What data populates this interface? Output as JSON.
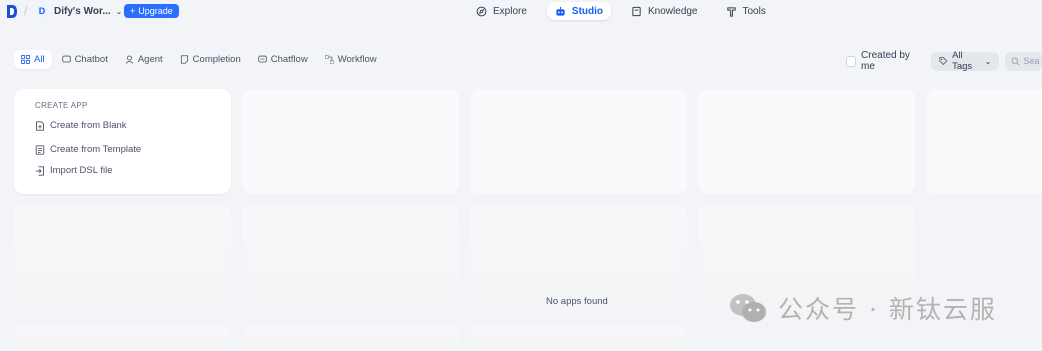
{
  "header": {
    "workspace_initial": "D",
    "workspace_name": "Dify's Wor...",
    "upgrade_label": "Upgrade",
    "nav": [
      {
        "label": "Explore",
        "icon": "compass-icon"
      },
      {
        "label": "Studio",
        "icon": "robot-icon",
        "active": true
      },
      {
        "label": "Knowledge",
        "icon": "book-icon"
      },
      {
        "label": "Tools",
        "icon": "hammer-icon"
      }
    ]
  },
  "tabs": [
    {
      "label": "All",
      "icon": "grid-icon",
      "active": true
    },
    {
      "label": "Chatbot",
      "icon": "chat-icon"
    },
    {
      "label": "Agent",
      "icon": "agent-icon"
    },
    {
      "label": "Completion",
      "icon": "document-icon"
    },
    {
      "label": "Chatflow",
      "icon": "chatflow-icon"
    },
    {
      "label": "Workflow",
      "icon": "workflow-icon"
    }
  ],
  "filters": {
    "created_by_me_label": "Created by me",
    "created_by_me_checked": false,
    "tags_label": "All Tags",
    "search_placeholder": "Sea"
  },
  "create_app": {
    "title": "CREATE APP",
    "items": [
      {
        "label": "Create from Blank",
        "icon": "blank-file-icon"
      },
      {
        "label": "Create from Template",
        "icon": "template-icon"
      },
      {
        "label": "Import DSL file",
        "icon": "import-icon"
      }
    ]
  },
  "empty_state": "No apps found",
  "watermark": {
    "text": "公众号 · 新钛云服",
    "icon": "wechat-icon"
  },
  "colors": {
    "accent": "#155eef",
    "upgrade": "#2970ff",
    "background": "#f2f4f7"
  }
}
